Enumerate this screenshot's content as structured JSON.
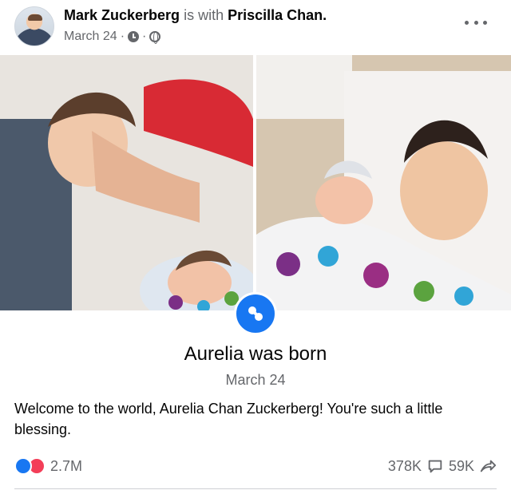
{
  "post": {
    "author": "Mark Zuckerberg",
    "with_text": "is with",
    "tagged": "Priscilla Chan.",
    "date": "March 24",
    "separator": "·",
    "more_label": "⋯"
  },
  "life_event": {
    "title": "Aurelia was born",
    "date": "March 24"
  },
  "caption": "Welcome to the world, Aurelia Chan Zuckerberg! You're such a little blessing.",
  "engagement": {
    "reactions_count": "2.7M",
    "comments_count": "378K",
    "shares_count": "59K"
  },
  "colors": {
    "brand_blue": "#1877f2",
    "love_red": "#f33e58",
    "muted_text": "#65676b"
  },
  "icons": [
    "clock-icon",
    "globe-icon",
    "more-icon",
    "pacifier-icon",
    "like-icon",
    "love-icon",
    "comment-icon",
    "share-icon"
  ]
}
